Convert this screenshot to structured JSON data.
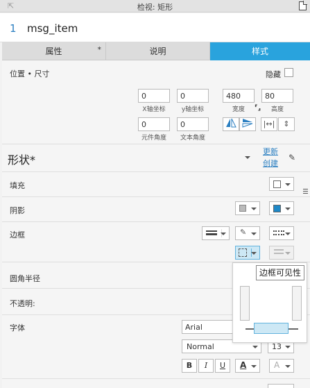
{
  "title": "检视: 矩形",
  "item": {
    "index": "1",
    "name": "msg_item"
  },
  "tabs": [
    {
      "label": "属性",
      "modified": "*"
    },
    {
      "label": "说明"
    },
    {
      "label": "样式"
    }
  ],
  "position": {
    "section_label": "位置 • 尺寸",
    "hide_label": "隐藏",
    "x": {
      "value": "0",
      "caption": "X轴坐标"
    },
    "y": {
      "value": "0",
      "caption": "y轴坐标"
    },
    "width": {
      "value": "480",
      "caption": "宽度"
    },
    "height": {
      "value": "80",
      "caption": "高度"
    },
    "element_angle": {
      "value": "0",
      "caption": "元件角度"
    },
    "text_angle": {
      "value": "0",
      "caption": "文本角度"
    }
  },
  "shape": {
    "label": "形状*",
    "update_link": "更新",
    "create_link": "创建"
  },
  "fill_label": "填充",
  "shadow_label": "阴影",
  "border_label": "边框",
  "corner_label": "圆角半径",
  "opacity_label": "不透明:",
  "font": {
    "label": "字体",
    "family": "Arial",
    "weight": "Normal",
    "size": "13",
    "bold": "B",
    "italic": "I",
    "underline": "U",
    "color_glyph": "A",
    "shadow_glyph": "A"
  },
  "tooltip": "边框可见性",
  "colors": {
    "accent": "#29a3dd",
    "link": "#2b7fc1",
    "shadow_blue": "#1e88c7"
  }
}
